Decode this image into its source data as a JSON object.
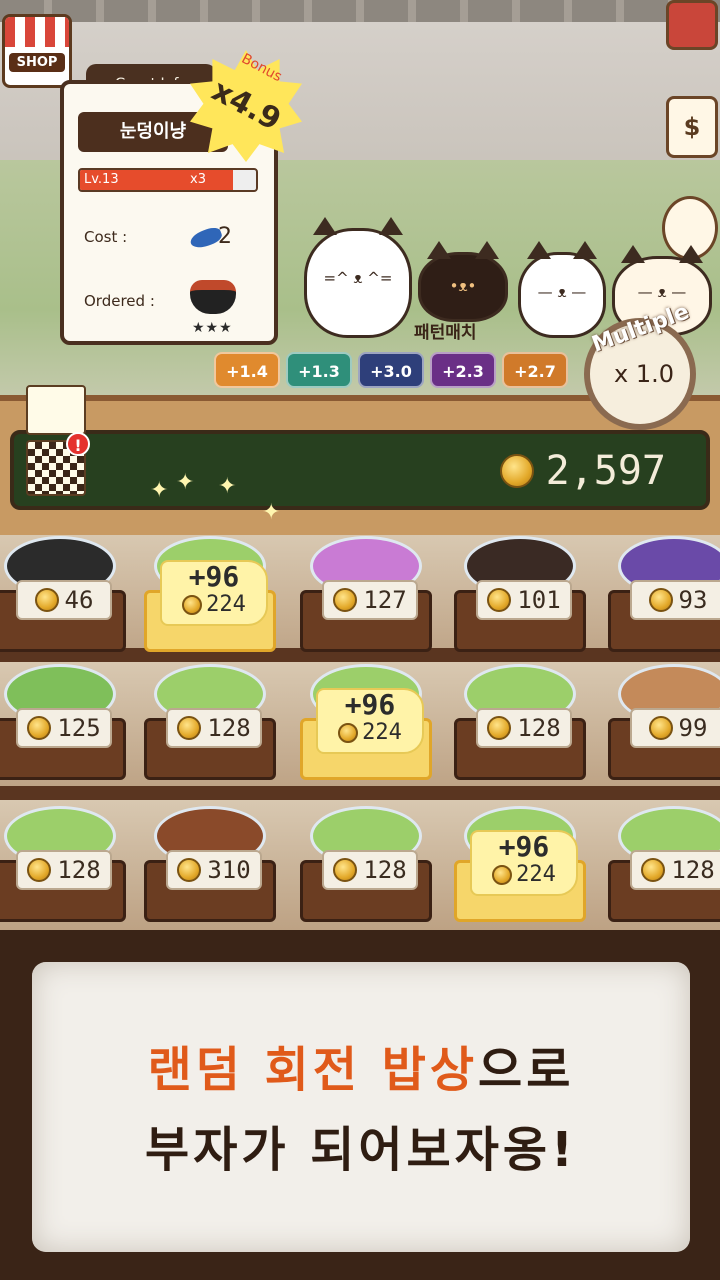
{
  "shop": {
    "label": "SHOP",
    "icon": "shop-icon"
  },
  "side_buttons": [
    {
      "icon": "book-icon"
    },
    {
      "icon": "receipt-dollar-icon",
      "symbol": "$"
    },
    {
      "icon": "chef-hat-icon"
    }
  ],
  "guest_info": {
    "tab": "Guest Info",
    "name": "눈덩이냥",
    "level": "Lv.13",
    "multiplier": "x3",
    "level_progress": 0.87,
    "cost_label": "Cost :",
    "cost_value": "2",
    "ordered_label": "Ordered :",
    "ordered_icon": "stew-pot-icon",
    "ordered_stars": "★★★"
  },
  "bonus": {
    "label": "Bonus",
    "value": "x4.9"
  },
  "guest_cat_label": "패턴매치",
  "chips": [
    {
      "label": "+1.4",
      "color": "#e08a2e"
    },
    {
      "label": "+1.3",
      "color": "#2f8f7a"
    },
    {
      "label": "+3.0",
      "color": "#2e3f7a"
    },
    {
      "label": "+2.3",
      "color": "#6a2f86"
    },
    {
      "label": "+2.7",
      "color": "#d07a2a"
    }
  ],
  "multiple": {
    "label": "Multiple",
    "value": "x 1.0"
  },
  "coins": {
    "value": "2,597"
  },
  "rows": [
    [
      {
        "price": "46"
      },
      {
        "plus": "+96",
        "total": "224",
        "highlight": true
      },
      {
        "price": "127"
      },
      {
        "price": "101"
      },
      {
        "price": "93"
      }
    ],
    [
      {
        "price": "125"
      },
      {
        "price": "128"
      },
      {
        "plus": "+96",
        "total": "224",
        "highlight": true
      },
      {
        "price": "128"
      },
      {
        "price": "99"
      }
    ],
    [
      {
        "price": "128"
      },
      {
        "price": "310"
      },
      {
        "price": "128"
      },
      {
        "plus": "+96",
        "total": "224",
        "highlight": true
      },
      {
        "price": "128"
      }
    ]
  ],
  "banner": {
    "line1_highlight": "랜덤 회전 밥상",
    "line1_rest": "으로",
    "line2": "부자가 되어보자옹!"
  }
}
